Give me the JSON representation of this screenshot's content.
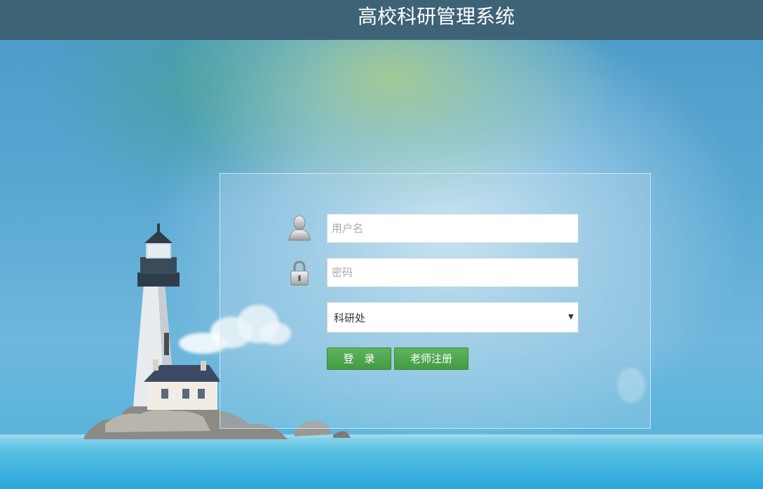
{
  "header": {
    "title": "高校科研管理系统"
  },
  "login": {
    "username_placeholder": "用户名",
    "username_value": "",
    "password_placeholder": "密码",
    "password_value": "",
    "role_selected": "科研处",
    "login_button": "登　录",
    "register_button": "老师注册"
  },
  "icons": {
    "user": "user-icon",
    "lock": "lock-icon",
    "dropdown": "caret-down-icon"
  },
  "colors": {
    "header_bg": "#3e6276",
    "button_green": "#4aa34a",
    "panel_border": "#e1f0fa"
  }
}
